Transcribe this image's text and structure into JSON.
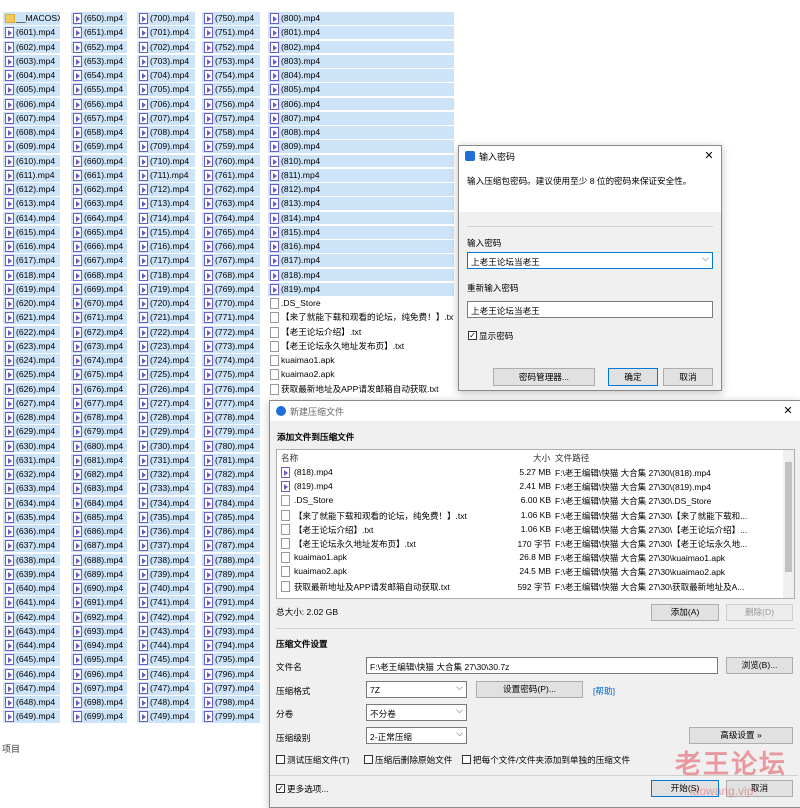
{
  "explorer": {
    "col1": [
      "__MACOSX",
      "(601).mp4",
      "(602).mp4",
      "(603).mp4",
      "(604).mp4",
      "(605).mp4",
      "(606).mp4",
      "(607).mp4",
      "(608).mp4",
      "(609).mp4",
      "(610).mp4",
      "(611).mp4",
      "(612).mp4",
      "(613).mp4",
      "(614).mp4",
      "(615).mp4",
      "(616).mp4",
      "(617).mp4",
      "(618).mp4",
      "(619).mp4",
      "(620).mp4",
      "(621).mp4",
      "(622).mp4",
      "(623).mp4",
      "(624).mp4",
      "(625).mp4",
      "(626).mp4",
      "(627).mp4",
      "(628).mp4",
      "(629).mp4",
      "(630).mp4",
      "(631).mp4",
      "(632).mp4",
      "(633).mp4",
      "(634).mp4",
      "(635).mp4",
      "(636).mp4",
      "(637).mp4",
      "(638).mp4",
      "(639).mp4",
      "(640).mp4",
      "(641).mp4",
      "(642).mp4",
      "(643).mp4",
      "(644).mp4",
      "(645).mp4",
      "(646).mp4",
      "(647).mp4",
      "(648).mp4",
      "(649).mp4"
    ],
    "col2": [
      "(650).mp4",
      "(651).mp4",
      "(652).mp4",
      "(653).mp4",
      "(654).mp4",
      "(655).mp4",
      "(656).mp4",
      "(657).mp4",
      "(658).mp4",
      "(659).mp4",
      "(660).mp4",
      "(661).mp4",
      "(662).mp4",
      "(663).mp4",
      "(664).mp4",
      "(665).mp4",
      "(666).mp4",
      "(667).mp4",
      "(668).mp4",
      "(669).mp4",
      "(670).mp4",
      "(671).mp4",
      "(672).mp4",
      "(673).mp4",
      "(674).mp4",
      "(675).mp4",
      "(676).mp4",
      "(677).mp4",
      "(678).mp4",
      "(679).mp4",
      "(680).mp4",
      "(681).mp4",
      "(682).mp4",
      "(683).mp4",
      "(684).mp4",
      "(685).mp4",
      "(686).mp4",
      "(687).mp4",
      "(688).mp4",
      "(689).mp4",
      "(690).mp4",
      "(691).mp4",
      "(692).mp4",
      "(693).mp4",
      "(694).mp4",
      "(695).mp4",
      "(696).mp4",
      "(697).mp4",
      "(698).mp4",
      "(699).mp4"
    ],
    "col3": [
      "(700).mp4",
      "(701).mp4",
      "(702).mp4",
      "(703).mp4",
      "(704).mp4",
      "(705).mp4",
      "(706).mp4",
      "(707).mp4",
      "(708).mp4",
      "(709).mp4",
      "(710).mp4",
      "(711).mp4",
      "(712).mp4",
      "(713).mp4",
      "(714).mp4",
      "(715).mp4",
      "(716).mp4",
      "(717).mp4",
      "(718).mp4",
      "(719).mp4",
      "(720).mp4",
      "(721).mp4",
      "(722).mp4",
      "(723).mp4",
      "(724).mp4",
      "(725).mp4",
      "(726).mp4",
      "(727).mp4",
      "(728).mp4",
      "(729).mp4",
      "(730).mp4",
      "(731).mp4",
      "(732).mp4",
      "(733).mp4",
      "(734).mp4",
      "(735).mp4",
      "(736).mp4",
      "(737).mp4",
      "(738).mp4",
      "(739).mp4",
      "(740).mp4",
      "(741).mp4",
      "(742).mp4",
      "(743).mp4",
      "(744).mp4",
      "(745).mp4",
      "(746).mp4",
      "(747).mp4",
      "(748).mp4",
      "(749).mp4"
    ],
    "col4": [
      "(750).mp4",
      "(751).mp4",
      "(752).mp4",
      "(753).mp4",
      "(754).mp4",
      "(755).mp4",
      "(756).mp4",
      "(757).mp4",
      "(758).mp4",
      "(759).mp4",
      "(760).mp4",
      "(761).mp4",
      "(762).mp4",
      "(763).mp4",
      "(764).mp4",
      "(765).mp4",
      "(766).mp4",
      "(767).mp4",
      "(768).mp4",
      "(769).mp4",
      "(770).mp4",
      "(771).mp4",
      "(772).mp4",
      "(773).mp4",
      "(774).mp4",
      "(775).mp4",
      "(776).mp4",
      "(777).mp4",
      "(778).mp4",
      "(779).mp4",
      "(780).mp4",
      "(781).mp4",
      "(782).mp4",
      "(783).mp4",
      "(784).mp4",
      "(785).mp4",
      "(786).mp4",
      "(787).mp4",
      "(788).mp4",
      "(789).mp4",
      "(790).mp4",
      "(791).mp4",
      "(792).mp4",
      "(793).mp4",
      "(794).mp4",
      "(795).mp4",
      "(796).mp4",
      "(797).mp4",
      "(798).mp4",
      "(799).mp4"
    ],
    "col5": [
      "(800).mp4",
      "(801).mp4",
      "(802).mp4",
      "(803).mp4",
      "(804).mp4",
      "(805).mp4",
      "(806).mp4",
      "(807).mp4",
      "(808).mp4",
      "(809).mp4",
      "(810).mp4",
      "(811).mp4",
      "(812).mp4",
      "(813).mp4",
      "(814).mp4",
      "(815).mp4",
      "(816).mp4",
      "(817).mp4",
      "(818).mp4",
      "(819).mp4",
      ".DS_Store",
      "【来了就能下载和观看的论坛，纯免费！】.txt",
      "【老王论坛介绍】.txt",
      "【老王论坛永久地址发布页】.txt",
      "kuaimao1.apk",
      "kuaimao2.apk",
      "获取最新地址及APP请发邮箱自动获取.txt"
    ],
    "status": "项目"
  },
  "pwd": {
    "title": "输入密码",
    "intro": "输入压缩包密码。建议使用至少 8 位的密码来保证安全性。",
    "enter_label": "输入密码",
    "enter_value": "上老王论坛当老王",
    "reenter_label": "重新输入密码",
    "reenter_value": "上老王论坛当老王",
    "show_label": "显示密码",
    "manager_btn": "密码管理器...",
    "ok_btn": "确定",
    "cancel_btn": "取消",
    "close": "✕"
  },
  "arc": {
    "title": "新建压缩文件",
    "close": "✕",
    "add_section": "添加文件到压缩文件",
    "cols": {
      "name": "名称",
      "size": "大小",
      "path": "文件路径"
    },
    "rows": [
      {
        "name": "(818).mp4",
        "size": "5.27 MB",
        "path": "F:\\老王编辑\\快猫 大合集 27\\30\\(818).mp4",
        "icon": "vid"
      },
      {
        "name": "(819).mp4",
        "size": "2.41 MB",
        "path": "F:\\老王编辑\\快猫 大合集 27\\30\\(819).mp4",
        "icon": "vid"
      },
      {
        "name": ".DS_Store",
        "size": "6.00 KB",
        "path": "F:\\老王编辑\\快猫 大合集 27\\30\\.DS_Store",
        "icon": "doc"
      },
      {
        "name": "【来了就能下载和观看的论坛，纯免费！】.txt",
        "size": "1.06 KB",
        "path": "F:\\老王编辑\\快猫 大合集 27\\30\\【来了就能下载和...",
        "icon": "doc"
      },
      {
        "name": "【老王论坛介绍】.txt",
        "size": "1.06 KB",
        "path": "F:\\老王编辑\\快猫 大合集 27\\30\\【老王论坛介绍】...",
        "icon": "doc"
      },
      {
        "name": "【老王论坛永久地址发布页】.txt",
        "size": "170 字节",
        "path": "F:\\老王编辑\\快猫 大合集 27\\30\\【老王论坛永久地...",
        "icon": "doc"
      },
      {
        "name": "kuaimao1.apk",
        "size": "26.8 MB",
        "path": "F:\\老王编辑\\快猫 大合集 27\\30\\kuaimao1.apk",
        "icon": "doc"
      },
      {
        "name": "kuaimao2.apk",
        "size": "24.5 MB",
        "path": "F:\\老王编辑\\快猫 大合集 27\\30\\kuaimao2.apk",
        "icon": "doc"
      },
      {
        "name": "获取最新地址及APP请发邮箱自动获取.txt",
        "size": "592 字节",
        "path": "F:\\老王编辑\\快猫 大合集 27\\30\\获取最新地址及A...",
        "icon": "doc"
      }
    ],
    "total": "总大小: 2.02 GB",
    "add_btn": "添加(A)",
    "delete_btn": "删除(D)",
    "settings_section": "压缩文件设置",
    "filename_label": "文件名",
    "filename_value": "F:\\老王编辑\\快猫 大合集 27\\30\\30.7z",
    "browse_btn": "浏览(B)...",
    "format_label": "压缩格式",
    "format_value": "7Z",
    "setpwd_btn": "设置密码(P)...",
    "help_link": "[帮助]",
    "split_label": "分卷",
    "split_value": "不分卷",
    "level_label": "压缩级别",
    "level_value": "2-正常压缩",
    "advanced_btn": "高级设置 »",
    "cb_test": "测试压缩文件(T)",
    "cb_delete": "压缩后删除原始文件",
    "cb_each": "把每个文件/文件夹添加到单独的压缩文件",
    "more_options": "更多选项...",
    "start_btn": "开始(S)",
    "cancel_btn": "取消"
  },
  "watermark": {
    "text": "老王论坛",
    "url": "laowang.vip"
  },
  "colors": {
    "selection": "#cde3f7",
    "accent": "#0078d7",
    "watermark": "#e3525c"
  }
}
